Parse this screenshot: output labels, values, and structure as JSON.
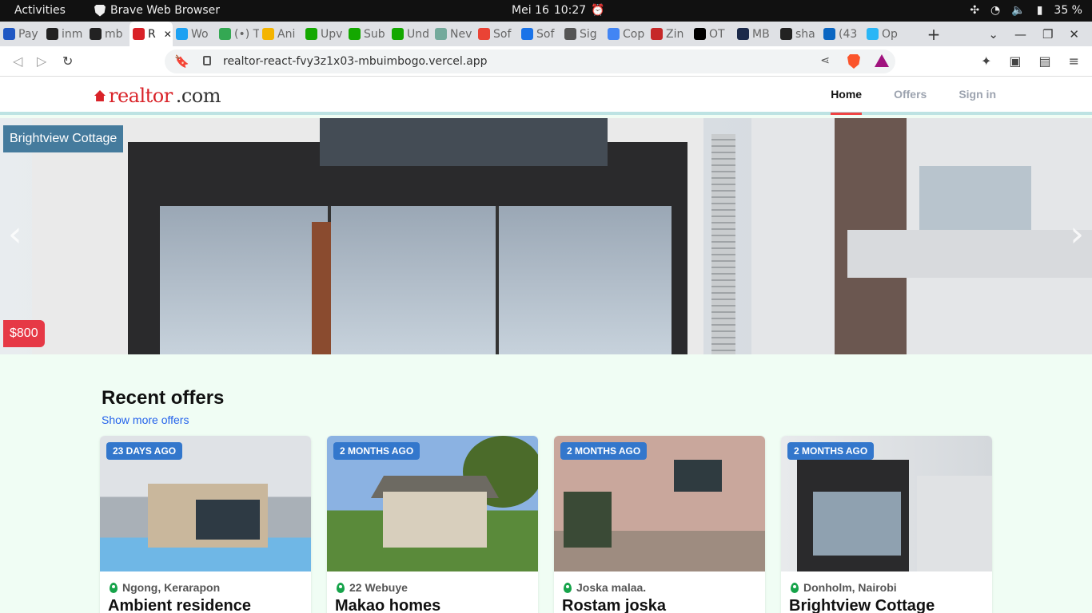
{
  "os": {
    "activities": "Activities",
    "app_name": "Brave Web Browser",
    "date": "Mei 16",
    "time": "10:27",
    "battery": "35 %"
  },
  "browser": {
    "tabs": [
      {
        "label": "Pay",
        "icon": "upwork-icon",
        "color": "#1f57c3"
      },
      {
        "label": "inm",
        "icon": "github-icon",
        "color": "#222222"
      },
      {
        "label": "mb",
        "icon": "github-icon",
        "color": "#222222"
      },
      {
        "label": "R",
        "icon": "realtor-icon",
        "color": "#d92228"
      },
      {
        "label": "Wo",
        "icon": "tumblr-icon",
        "color": "#1da1f2"
      },
      {
        "label": "(•) T",
        "icon": "maps-icon",
        "color": "#34a853"
      },
      {
        "label": "Ani",
        "icon": "ring-icon",
        "color": "#f4b400"
      },
      {
        "label": "Upv",
        "icon": "upwork-icon",
        "color": "#14a800"
      },
      {
        "label": "Sub",
        "icon": "upwork-icon",
        "color": "#14a800"
      },
      {
        "label": "Und",
        "icon": "upwork-icon",
        "color": "#14a800"
      },
      {
        "label": "Nev",
        "icon": "chatgpt-icon",
        "color": "#74aa9c"
      },
      {
        "label": "Sof",
        "icon": "gmail-icon",
        "color": "#ea4335"
      },
      {
        "label": "Sof",
        "icon": "info-icon",
        "color": "#1a73e8"
      },
      {
        "label": "Sig",
        "icon": "globe-icon",
        "color": "#555555"
      },
      {
        "label": "Cop",
        "icon": "docs-icon",
        "color": "#4285f4"
      },
      {
        "label": "Zin",
        "icon": "zinc-icon",
        "color": "#c62828"
      },
      {
        "label": "OT",
        "icon": "ot-icon",
        "color": "#000000"
      },
      {
        "label": "MB",
        "icon": "pe-icon",
        "color": "#1b2a4a"
      },
      {
        "label": "sha",
        "icon": "github-icon",
        "color": "#222222"
      },
      {
        "label": "(43",
        "icon": "linkedin-icon",
        "color": "#0a66c2"
      },
      {
        "label": "Op",
        "icon": "wave-icon",
        "color": "#29b6f6"
      }
    ],
    "url": "realtor-react-fvy3z1x03-mbuimbogo.vercel.app",
    "rewards_count": "1"
  },
  "site": {
    "logo_main": "realtor",
    "logo_suffix": ".com",
    "nav": {
      "home": "Home",
      "offers": "Offers",
      "sign_in": "Sign in"
    },
    "accent": "#ef4444"
  },
  "hero": {
    "title": "Brightview Cottage",
    "price": "$800",
    "prev": "‹",
    "next": "›"
  },
  "recent": {
    "heading": "Recent offers",
    "show_more": "Show more offers",
    "cards": [
      {
        "badge": "23 DAYS AGO",
        "location": "Ngong, Kerarapon",
        "name": "Ambient residence"
      },
      {
        "badge": "2 MONTHS AGO",
        "location": "22 Webuye",
        "name": "Makao homes"
      },
      {
        "badge": "2 MONTHS AGO",
        "location": "Joska malaa.",
        "name": "Rostam joska"
      },
      {
        "badge": "2 MONTHS AGO",
        "location": "Donholm, Nairobi",
        "name": "Brightview Cottage"
      }
    ]
  }
}
